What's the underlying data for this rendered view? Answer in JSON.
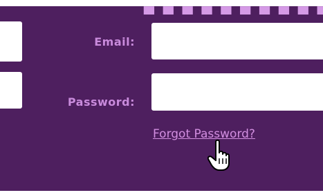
{
  "form": {
    "email_label": "Email:",
    "email_value": "",
    "password_label": "Password:",
    "password_value": "",
    "forgot_link": "Forgot Password?"
  },
  "colors": {
    "panel": "#4e1f5f",
    "label": "#c98bdc",
    "link": "#d28ee0"
  },
  "cursor": {
    "icon": "hand-pointer-icon"
  }
}
